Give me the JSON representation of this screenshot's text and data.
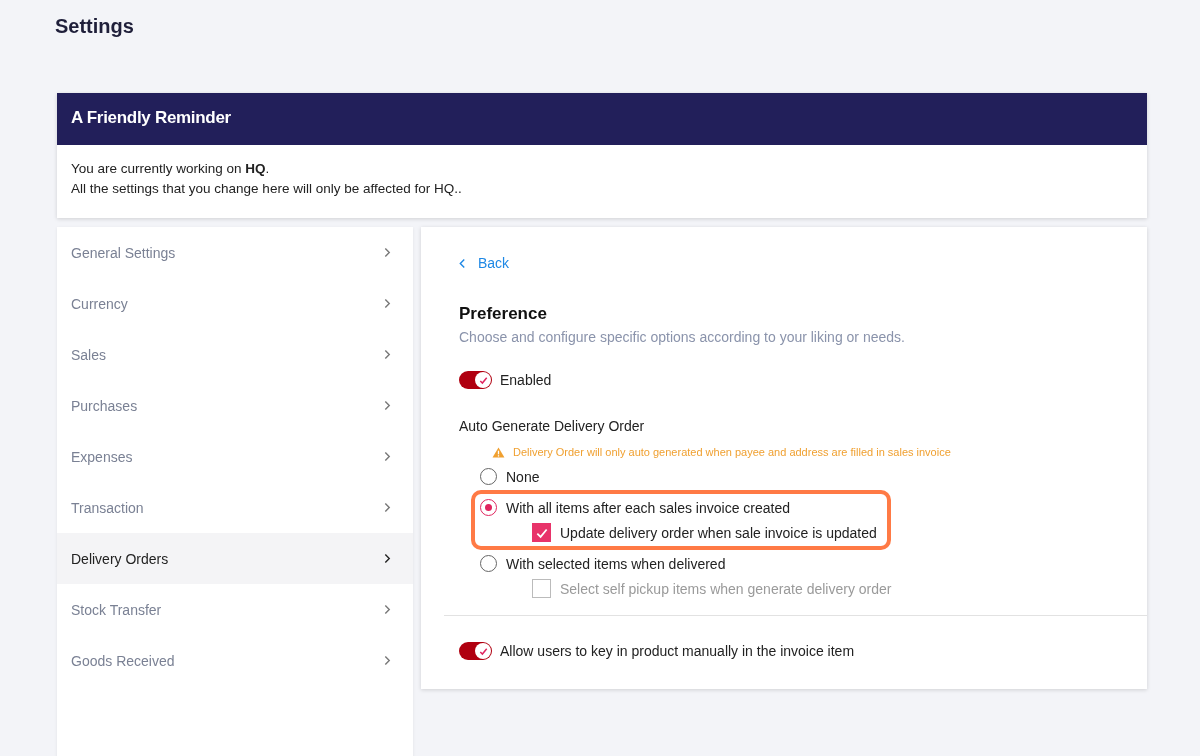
{
  "page_title": "Settings",
  "reminder": {
    "title": "A Friendly Reminder",
    "lines": [
      "You are currently working on **HQ**.",
      "All the settings that you change here will only be affected for HQ.."
    ]
  },
  "sidebar": {
    "items": [
      {
        "label": "General Settings",
        "selected": false
      },
      {
        "label": "Currency",
        "selected": false
      },
      {
        "label": "Sales",
        "selected": false
      },
      {
        "label": "Purchases",
        "selected": false
      },
      {
        "label": "Expenses",
        "selected": false
      },
      {
        "label": "Transaction",
        "selected": false
      },
      {
        "label": "Delivery Orders",
        "selected": true
      },
      {
        "label": "Stock Transfer",
        "selected": false
      },
      {
        "label": "Goods Received",
        "selected": false
      }
    ]
  },
  "panel": {
    "back": "Back",
    "title": "Preference",
    "subtitle": "Choose and configure specific options according to your liking or needs.",
    "enabled_toggle": {
      "label": "Enabled",
      "on": true
    },
    "group_label": "Auto Generate Delivery Order",
    "warning": "Delivery Order will only auto generated when payee and address are filled in sales invoice",
    "options": [
      {
        "label": "None",
        "selected": false,
        "highlighted": false
      },
      {
        "label": "With all items after each sales invoice created",
        "selected": true,
        "highlighted": true,
        "sub": {
          "label": "Update delivery order when sale invoice is updated",
          "checked": true,
          "disabled": false
        }
      },
      {
        "label": "With selected items when delivered",
        "selected": false,
        "highlighted": false,
        "sub": {
          "label": "Select self pickup items when generate delivery order",
          "checked": false,
          "disabled": true
        }
      }
    ],
    "manual_toggle": {
      "label": "Allow users to key in product manually in the invoice item",
      "on": true
    }
  }
}
